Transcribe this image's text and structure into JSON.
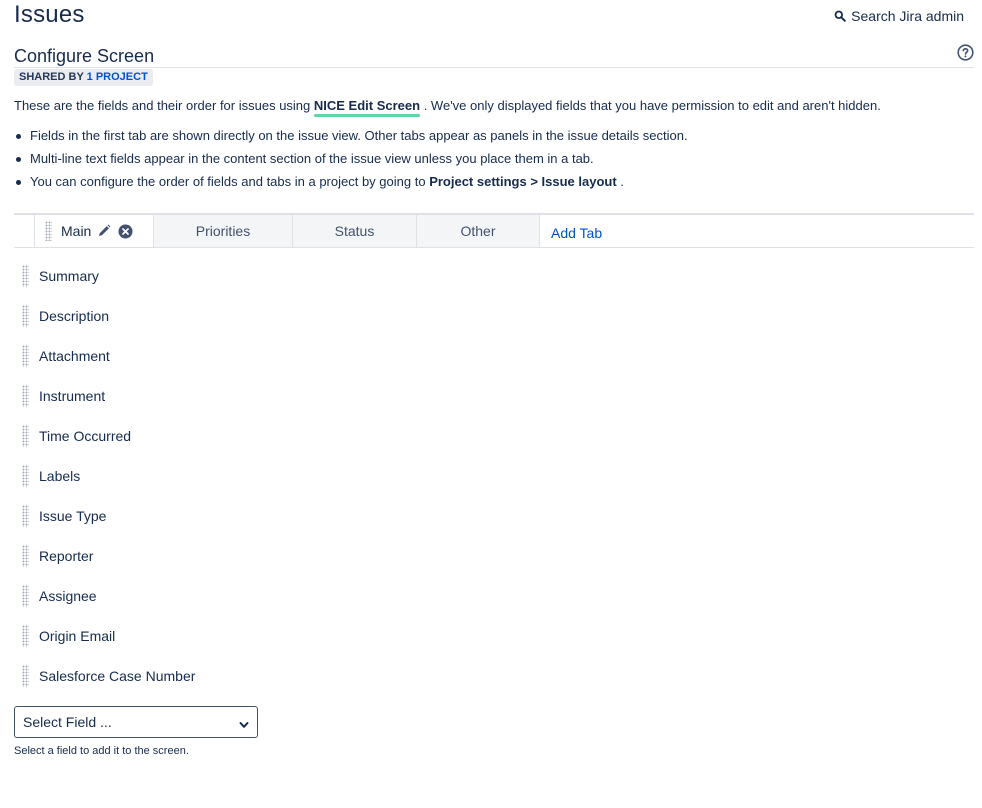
{
  "header": {
    "title": "Issues",
    "search_label": "Search Jira admin",
    "search_icon": "search-icon"
  },
  "section": {
    "title": "Configure Screen",
    "help_icon": "help-icon",
    "shared_prefix": "SHARED BY",
    "shared_link": "1 PROJECT"
  },
  "intro": {
    "before": "These are the fields and their order for issues using ",
    "screen_name": "NICE Edit Screen",
    "after": " . We've only displayed fields that you have permission to edit and aren't hidden."
  },
  "bullets": {
    "b1": "Fields in the first tab are shown directly on the issue view. Other tabs appear as panels in the issue details section.",
    "b2": "Multi-line text fields appear in the content section of the issue view unless you place them in a tab.",
    "b3_before": "You can configure the order of fields and tabs in a project by going to ",
    "b3_settings": "Project settings",
    "b3_sep": " > ",
    "b3_layout": "Issue layout",
    "b3_after": " ."
  },
  "tabs": {
    "items": [
      {
        "label": "Main",
        "active": true
      },
      {
        "label": "Priorities"
      },
      {
        "label": "Status"
      },
      {
        "label": "Other"
      }
    ],
    "add_label": "Add Tab"
  },
  "fields": [
    "Summary",
    "Description",
    "Attachment",
    "Instrument",
    "Time Occurred",
    "Labels",
    "Issue Type",
    "Reporter",
    "Assignee",
    "Origin Email",
    "Salesforce Case Number"
  ],
  "select_field": {
    "value": "Select Field ...",
    "hint": "Select a field to add it to the screen."
  },
  "colors": {
    "link": "#0052cc",
    "text": "#172b4d",
    "highlight": "#57d9a3",
    "tab_bg": "#f4f5f7"
  }
}
